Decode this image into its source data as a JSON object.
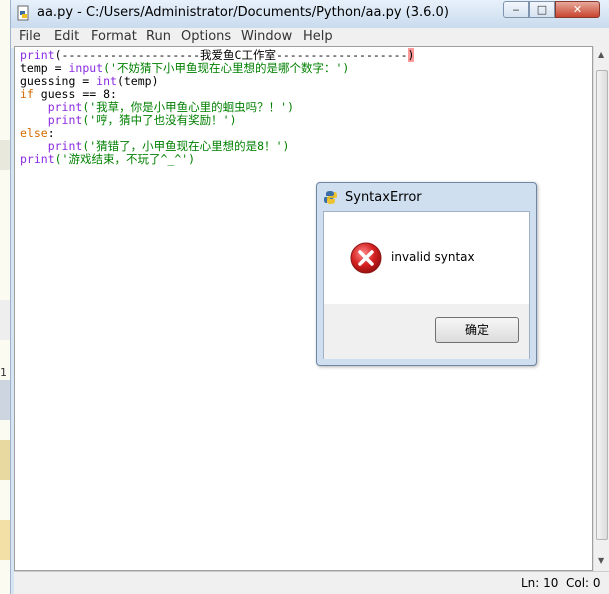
{
  "window": {
    "title": "aa.py - C:/Users/Administrator/Documents/Python/aa.py (3.6.0)",
    "min_label": "‒",
    "max_label": "□",
    "close_label": "✕"
  },
  "menu": {
    "items": [
      "File",
      "Edit",
      "Format",
      "Run",
      "Options",
      "Window",
      "Help"
    ]
  },
  "code": {
    "lines": [
      [
        {
          "c": "bi",
          "t": "print"
        },
        {
          "c": "txt",
          "t": "(--------------------我爱鱼C工作室-------------------"
        },
        {
          "c": "cursor",
          "t": ")"
        }
      ],
      [
        {
          "c": "txt",
          "t": "temp = "
        },
        {
          "c": "bi",
          "t": "input"
        },
        {
          "c": "str",
          "t": "('不妨猜下小甲鱼现在心里想的是哪个数字：')"
        }
      ],
      [
        {
          "c": "txt",
          "t": "guessing = "
        },
        {
          "c": "bi",
          "t": "int"
        },
        {
          "c": "txt",
          "t": "(temp)"
        }
      ],
      [
        {
          "c": "kw",
          "t": "if"
        },
        {
          "c": "txt",
          "t": " guess == 8:"
        }
      ],
      [
        {
          "c": "txt",
          "t": "    "
        },
        {
          "c": "bi",
          "t": "print"
        },
        {
          "c": "str",
          "t": "('我草，你是小甲鱼心里的蛔虫吗？！')"
        }
      ],
      [
        {
          "c": "txt",
          "t": "    "
        },
        {
          "c": "bi",
          "t": "print"
        },
        {
          "c": "str",
          "t": "('哼，猜中了也没有奖励！')"
        }
      ],
      [
        {
          "c": "kw",
          "t": "else"
        },
        {
          "c": "txt",
          "t": ":"
        }
      ],
      [
        {
          "c": "txt",
          "t": "    "
        },
        {
          "c": "bi",
          "t": "print"
        },
        {
          "c": "str",
          "t": "('猜错了，小甲鱼现在心里想的是8！')"
        }
      ],
      [
        {
          "c": "bi",
          "t": "print"
        },
        {
          "c": "str",
          "t": "('游戏结束，不玩了^_^')"
        }
      ]
    ]
  },
  "status": {
    "line": "Ln: 10",
    "col": "Col: 0"
  },
  "dialog": {
    "title": "SyntaxError",
    "message": "invalid syntax",
    "ok_label": "确定"
  },
  "colors": {
    "keyword": "#d46a00",
    "builtin": "#8a2be2",
    "string": "#008000",
    "error_icon": "#d42020"
  },
  "icons": {
    "app": "python-file-icon",
    "error": "error-x-icon",
    "dialog": "python-icon"
  },
  "side_label": "1"
}
